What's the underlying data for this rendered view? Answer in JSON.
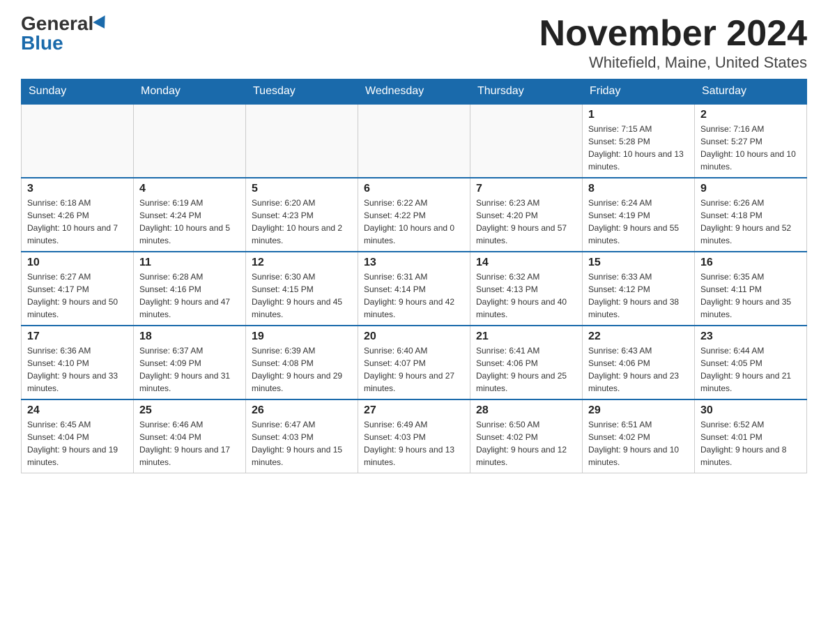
{
  "logo": {
    "general": "General",
    "blue": "Blue"
  },
  "title": "November 2024",
  "subtitle": "Whitefield, Maine, United States",
  "weekdays": [
    "Sunday",
    "Monday",
    "Tuesday",
    "Wednesday",
    "Thursday",
    "Friday",
    "Saturday"
  ],
  "weeks": [
    [
      {
        "day": "",
        "info": ""
      },
      {
        "day": "",
        "info": ""
      },
      {
        "day": "",
        "info": ""
      },
      {
        "day": "",
        "info": ""
      },
      {
        "day": "",
        "info": ""
      },
      {
        "day": "1",
        "info": "Sunrise: 7:15 AM\nSunset: 5:28 PM\nDaylight: 10 hours and 13 minutes."
      },
      {
        "day": "2",
        "info": "Sunrise: 7:16 AM\nSunset: 5:27 PM\nDaylight: 10 hours and 10 minutes."
      }
    ],
    [
      {
        "day": "3",
        "info": "Sunrise: 6:18 AM\nSunset: 4:26 PM\nDaylight: 10 hours and 7 minutes."
      },
      {
        "day": "4",
        "info": "Sunrise: 6:19 AM\nSunset: 4:24 PM\nDaylight: 10 hours and 5 minutes."
      },
      {
        "day": "5",
        "info": "Sunrise: 6:20 AM\nSunset: 4:23 PM\nDaylight: 10 hours and 2 minutes."
      },
      {
        "day": "6",
        "info": "Sunrise: 6:22 AM\nSunset: 4:22 PM\nDaylight: 10 hours and 0 minutes."
      },
      {
        "day": "7",
        "info": "Sunrise: 6:23 AM\nSunset: 4:20 PM\nDaylight: 9 hours and 57 minutes."
      },
      {
        "day": "8",
        "info": "Sunrise: 6:24 AM\nSunset: 4:19 PM\nDaylight: 9 hours and 55 minutes."
      },
      {
        "day": "9",
        "info": "Sunrise: 6:26 AM\nSunset: 4:18 PM\nDaylight: 9 hours and 52 minutes."
      }
    ],
    [
      {
        "day": "10",
        "info": "Sunrise: 6:27 AM\nSunset: 4:17 PM\nDaylight: 9 hours and 50 minutes."
      },
      {
        "day": "11",
        "info": "Sunrise: 6:28 AM\nSunset: 4:16 PM\nDaylight: 9 hours and 47 minutes."
      },
      {
        "day": "12",
        "info": "Sunrise: 6:30 AM\nSunset: 4:15 PM\nDaylight: 9 hours and 45 minutes."
      },
      {
        "day": "13",
        "info": "Sunrise: 6:31 AM\nSunset: 4:14 PM\nDaylight: 9 hours and 42 minutes."
      },
      {
        "day": "14",
        "info": "Sunrise: 6:32 AM\nSunset: 4:13 PM\nDaylight: 9 hours and 40 minutes."
      },
      {
        "day": "15",
        "info": "Sunrise: 6:33 AM\nSunset: 4:12 PM\nDaylight: 9 hours and 38 minutes."
      },
      {
        "day": "16",
        "info": "Sunrise: 6:35 AM\nSunset: 4:11 PM\nDaylight: 9 hours and 35 minutes."
      }
    ],
    [
      {
        "day": "17",
        "info": "Sunrise: 6:36 AM\nSunset: 4:10 PM\nDaylight: 9 hours and 33 minutes."
      },
      {
        "day": "18",
        "info": "Sunrise: 6:37 AM\nSunset: 4:09 PM\nDaylight: 9 hours and 31 minutes."
      },
      {
        "day": "19",
        "info": "Sunrise: 6:39 AM\nSunset: 4:08 PM\nDaylight: 9 hours and 29 minutes."
      },
      {
        "day": "20",
        "info": "Sunrise: 6:40 AM\nSunset: 4:07 PM\nDaylight: 9 hours and 27 minutes."
      },
      {
        "day": "21",
        "info": "Sunrise: 6:41 AM\nSunset: 4:06 PM\nDaylight: 9 hours and 25 minutes."
      },
      {
        "day": "22",
        "info": "Sunrise: 6:43 AM\nSunset: 4:06 PM\nDaylight: 9 hours and 23 minutes."
      },
      {
        "day": "23",
        "info": "Sunrise: 6:44 AM\nSunset: 4:05 PM\nDaylight: 9 hours and 21 minutes."
      }
    ],
    [
      {
        "day": "24",
        "info": "Sunrise: 6:45 AM\nSunset: 4:04 PM\nDaylight: 9 hours and 19 minutes."
      },
      {
        "day": "25",
        "info": "Sunrise: 6:46 AM\nSunset: 4:04 PM\nDaylight: 9 hours and 17 minutes."
      },
      {
        "day": "26",
        "info": "Sunrise: 6:47 AM\nSunset: 4:03 PM\nDaylight: 9 hours and 15 minutes."
      },
      {
        "day": "27",
        "info": "Sunrise: 6:49 AM\nSunset: 4:03 PM\nDaylight: 9 hours and 13 minutes."
      },
      {
        "day": "28",
        "info": "Sunrise: 6:50 AM\nSunset: 4:02 PM\nDaylight: 9 hours and 12 minutes."
      },
      {
        "day": "29",
        "info": "Sunrise: 6:51 AM\nSunset: 4:02 PM\nDaylight: 9 hours and 10 minutes."
      },
      {
        "day": "30",
        "info": "Sunrise: 6:52 AM\nSunset: 4:01 PM\nDaylight: 9 hours and 8 minutes."
      }
    ]
  ]
}
